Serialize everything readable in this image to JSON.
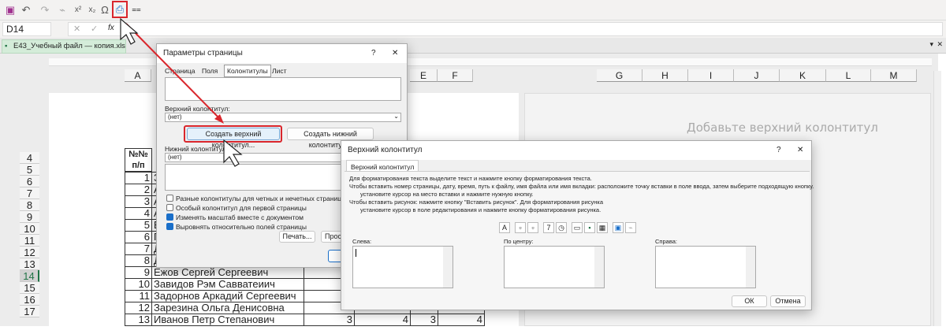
{
  "toolbar": {
    "name_box": "D14",
    "fx": "fx",
    "cancel": "✕",
    "enter": "✓"
  },
  "tab": {
    "file_name": "E43_Учебный файл — копия.xlsx *"
  },
  "columns": [
    "A",
    "E",
    "F",
    "G",
    "H",
    "I",
    "J",
    "K",
    "L",
    "M"
  ],
  "rows": [
    "4",
    "5",
    "6",
    "7",
    "8",
    "9",
    "10",
    "11",
    "12",
    "13",
    "14",
    "15",
    "16",
    "17"
  ],
  "selected_row": "14",
  "page": {
    "header_placeholder": "Добавьте верхний колонтитул"
  },
  "table": {
    "header": "№№ п/п",
    "rows": [
      {
        "n": "1",
        "name": "З"
      },
      {
        "n": "2",
        "name": "А"
      },
      {
        "n": "3",
        "name": "А"
      },
      {
        "n": "4",
        "name": "А"
      },
      {
        "n": "5",
        "name": "Е"
      },
      {
        "n": "6",
        "name": "Г"
      },
      {
        "n": "7",
        "name": "Д"
      },
      {
        "n": "8",
        "name": "Д"
      },
      {
        "n": "9",
        "name": "Ежов Сергей Сергеевич"
      },
      {
        "n": "10",
        "name": "Завидов Рэм Савватеиич"
      },
      {
        "n": "11",
        "name": "Задорнов Аркадий Сергеевич"
      },
      {
        "n": "12",
        "name": "Зарезина Ольга Денисовна"
      },
      {
        "n": "13",
        "name": "Иванов Петр Степанович",
        "v": [
          "3",
          "4",
          "3",
          "4"
        ]
      }
    ]
  },
  "page_setup": {
    "title": "Параметры страницы",
    "help": "?",
    "close": "✕",
    "tabs": [
      "Страница",
      "Поля",
      "Колонтитулы",
      "Лист"
    ],
    "active_tab": "Колонтитулы",
    "header_label": "Верхний колонтитул:",
    "header_value": "(нет)",
    "create_header": "Создать верхний колонтитул...",
    "create_footer": "Создать нижний колонтитул...",
    "footer_label": "Нижний колонтитул:",
    "footer_value": "(нет)",
    "options": [
      {
        "label": "Разные колонтитулы для четных и нечетных страниц",
        "checked": false
      },
      {
        "label": "Особый колонтитул для первой страницы",
        "checked": false
      },
      {
        "label": "Изменять масштаб вместе с документом",
        "checked": true
      },
      {
        "label": "Выровнять относительно полей страницы",
        "checked": true
      }
    ],
    "print": "Печать...",
    "preview": "Просм"
  },
  "header_dialog": {
    "title": "Верхний колонтитул",
    "help": "?",
    "close": "✕",
    "tab": "Верхний колонтитул",
    "instructions": [
      "Для форматирования текста выделите текст и нажмите кнопку форматирования текста.",
      "Чтобы вставить номер страницы, дату, время, путь к файлу, имя файла или имя вкладки: расположите точку вставки в поле ввода, затем выберите подходящую кнопку.",
      "установите курсор на место вставки и нажмите нужную кнопку.",
      "Чтобы вставить рисунок: нажмите кнопку \"Вставить рисунок\". Для форматирования рисунка",
      "установите курсор в поле редактирования и нажмите кнопку форматирования рисунка."
    ],
    "tool_icons": [
      "format-text",
      "page-number",
      "page-count",
      "date",
      "time",
      "file-path",
      "file-name",
      "sheet-name",
      "insert-picture",
      "format-picture"
    ],
    "left_label": "Слева:",
    "center_label": "По центру:",
    "right_label": "Справа:",
    "ok": "ОК",
    "cancel": "Отмена"
  },
  "colors": {
    "highlight": "#d9262c",
    "accent": "#1a6fc9",
    "sheet_green": "#217346"
  }
}
